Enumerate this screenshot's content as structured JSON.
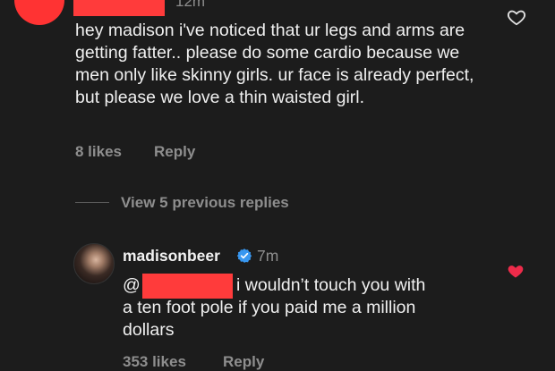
{
  "top_comment": {
    "timestamp": "12m",
    "text": "hey madison i've noticed that ur legs and arms are getting fatter.. please do some cardio because we men only like skinny girls. ur face is already perfect, but please we love a thin waisted girl.",
    "likes": "8 likes",
    "reply_label": "Reply",
    "heart_icon": "heart-outline-icon"
  },
  "thread": {
    "view_replies_label": "View 5 previous replies"
  },
  "reply_comment": {
    "username": "madisonbeer",
    "verified_icon": "verified-badge-icon",
    "timestamp": "7m",
    "mention_prefix": "@",
    "line1": "i wouldn’t touch you with",
    "line2": "a ten foot pole if you paid me a million",
    "line3": "dollars",
    "likes": "353 likes",
    "reply_label": "Reply",
    "heart_icon": "heart-filled-icon"
  },
  "colors": {
    "background": "#1c1c1c",
    "redaction": "#ff3b3b",
    "liked_heart": "#ed2b4a",
    "verified": "#3897f0",
    "secondary_text": "#8e8e8e"
  }
}
